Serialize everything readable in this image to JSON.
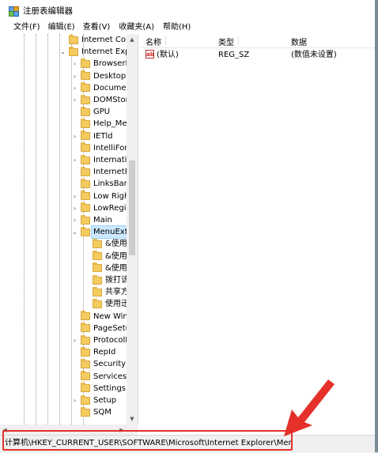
{
  "window": {
    "title": "注册表编辑器"
  },
  "menu": [
    {
      "label": "文件(F)"
    },
    {
      "label": "编辑(E)"
    },
    {
      "label": "查看(V)"
    },
    {
      "label": "收藏夹(A)"
    },
    {
      "label": "帮助(H)"
    }
  ],
  "tree": {
    "items": [
      {
        "label": "Internet Conr",
        "level": 0,
        "expander": ""
      },
      {
        "label": "Internet Explo",
        "level": 0,
        "expander": "expanded"
      },
      {
        "label": "BrowserEı",
        "level": 1,
        "expander": "collapsed"
      },
      {
        "label": "Desktop",
        "level": 1,
        "expander": "collapsed"
      },
      {
        "label": "Document",
        "level": 1,
        "expander": "collapsed"
      },
      {
        "label": "DOMStora",
        "level": 1,
        "expander": "collapsed"
      },
      {
        "label": "GPU",
        "level": 1,
        "expander": ""
      },
      {
        "label": "Help_Men",
        "level": 1,
        "expander": ""
      },
      {
        "label": "IETld",
        "level": 1,
        "expander": "collapsed"
      },
      {
        "label": "IntelliForm",
        "level": 1,
        "expander": ""
      },
      {
        "label": "Internatio",
        "level": 1,
        "expander": "collapsed"
      },
      {
        "label": "InternetRe",
        "level": 1,
        "expander": ""
      },
      {
        "label": "LinksBar",
        "level": 1,
        "expander": ""
      },
      {
        "label": "Low Right",
        "level": 1,
        "expander": "collapsed"
      },
      {
        "label": "LowRegist",
        "level": 1,
        "expander": "collapsed"
      },
      {
        "label": "Main",
        "level": 1,
        "expander": "collapsed"
      },
      {
        "label": "MenuExt",
        "level": 1,
        "expander": "expanded",
        "selected": true
      },
      {
        "label": "&使用&",
        "level": 2,
        "expander": ""
      },
      {
        "label": "&使用&",
        "level": 2,
        "expander": ""
      },
      {
        "label": "&使用&",
        "level": 2,
        "expander": ""
      },
      {
        "label": "拨打该",
        "level": 2,
        "expander": ""
      },
      {
        "label": "共享方",
        "level": 2,
        "expander": ""
      },
      {
        "label": "使用迅",
        "level": 2,
        "expander": ""
      },
      {
        "label": "New Winc",
        "level": 1,
        "expander": ""
      },
      {
        "label": "PageSetup",
        "level": 1,
        "expander": ""
      },
      {
        "label": "ProtocolE",
        "level": 1,
        "expander": "collapsed"
      },
      {
        "label": "RepId",
        "level": 1,
        "expander": ""
      },
      {
        "label": "Security",
        "level": 1,
        "expander": ""
      },
      {
        "label": "Services",
        "level": 1,
        "expander": ""
      },
      {
        "label": "Settings",
        "level": 1,
        "expander": ""
      },
      {
        "label": "Setup",
        "level": 1,
        "expander": "collapsed"
      },
      {
        "label": "SQM",
        "level": 1,
        "expander": ""
      }
    ]
  },
  "list": {
    "columns": [
      "名称",
      "类型",
      "数据"
    ],
    "rows": [
      {
        "icon": "string-value-icon",
        "name": "(默认)",
        "type": "REG_SZ",
        "data": "(数值未设置)"
      }
    ]
  },
  "status": {
    "path": "计算机\\HKEY_CURRENT_USER\\SOFTWARE\\Microsoft\\Internet Explorer\\MenuExt"
  },
  "annotation": {
    "color": "#e5312a"
  }
}
